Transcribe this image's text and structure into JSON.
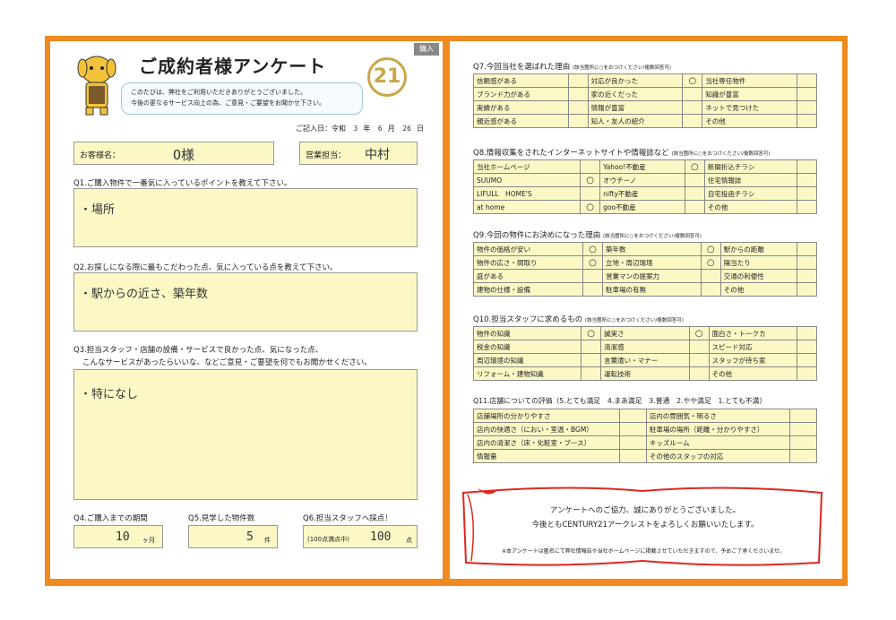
{
  "left": {
    "badge": "購入",
    "title": "ご成約者様アンケート",
    "intro_1": "このたびは、弊社をご利用いただきありがとうございました。",
    "intro_2": "今後の更なるサービス向上の為、ご意見・ご要望をお聞かせ下さい。",
    "logo": "21",
    "date_label": "ご記入日：令和",
    "date_year": "3",
    "date_month": "6",
    "date_day": "26",
    "date_y": "年",
    "date_m": "月",
    "date_d": "日",
    "customer_label": "お客様名：",
    "customer_value": "O様",
    "staff_label": "営業担当：",
    "staff_value": "中村",
    "q1": "Q1.ご購入物件で一番気に入っているポイントを教えて下さい。",
    "a1": "・場所",
    "q2": "Q2.お探しになる際に最もこだわった点、気に入っている点を教えて下さい。",
    "a2": "・駅からの近さ、築年数",
    "q3a": "Q3.担当スタッフ・店舗の設備・サービスで良かった点、気になった点、",
    "q3b": "こんなサービスがあったらいいな、などご意見・ご要望を何でもお聞かせください。",
    "a3": "・特になし",
    "q4": "Q4.ご購入までの期間",
    "a4": "10",
    "a4_unit": "ヶ月",
    "q5": "Q5.見学した物件数",
    "a5": "5",
    "a5_unit": "件",
    "q6": "Q6.担当スタッフへ採点！",
    "a6_note": "(100点満点中)",
    "a6": "100",
    "a6_unit": "点"
  },
  "right": {
    "q7": "Q7.今回当社を選ばれた理由",
    "q7_note": "(該当箇所に○をおつけください/複数回答可)",
    "q7_rows": [
      [
        "信頼感がある",
        "",
        "対応が良かった",
        "○",
        "当社専任物件",
        ""
      ],
      [
        "ブランド力がある",
        "",
        "家の近くだった",
        "",
        "知識が豊富",
        ""
      ],
      [
        "実績がある",
        "",
        "情報が豊富",
        "",
        "ネットで見つけた",
        ""
      ],
      [
        "親近感がある",
        "",
        "知人・友人の紹介",
        "",
        "その他",
        ""
      ]
    ],
    "q8": "Q8.情報収集をされたインターネットサイトや情報誌など",
    "q8_note": "(該当箇所に○をおつけください/複数回答可)",
    "q8_rows": [
      [
        "当社ホームページ",
        "",
        "Yahoo!不動産",
        "○",
        "新聞折込チラシ",
        ""
      ],
      [
        "SUUMO",
        "○",
        "オウチーノ",
        "",
        "住宅情報誌",
        ""
      ],
      [
        "LIFULL　HOME'S",
        "",
        "nifty不動産",
        "",
        "自宅投函チラシ",
        ""
      ],
      [
        "at home",
        "○",
        "goo不動産",
        "",
        "その他",
        ""
      ]
    ],
    "q9": "Q9.今回の物件にお決めになった理由",
    "q9_note": "(該当箇所に○をおつけください/複数回答可)",
    "q9_rows": [
      [
        "物件の価格が安い",
        "○",
        "築年数",
        "○",
        "駅からの距離",
        ""
      ],
      [
        "物件の広さ・間取り",
        "○",
        "立地・周辺環境",
        "○",
        "陽当たり",
        ""
      ],
      [
        "庭がある",
        "",
        "営業マンの提案力",
        "",
        "交通の利便性",
        ""
      ],
      [
        "建物の仕様・設備",
        "",
        "駐車場の有無",
        "",
        "その他",
        ""
      ]
    ],
    "q10": "Q10.担当スタッフに求めるもの",
    "q10_note": "(該当箇所に○をおつけください/複数回答可)",
    "q10_rows": [
      [
        "物件の知識",
        "○",
        "誠実さ",
        "○",
        "面白さ・トークカ",
        ""
      ],
      [
        "税金の知識",
        "",
        "清潔感",
        "",
        "スピード対応",
        ""
      ],
      [
        "周辺環境の知識",
        "",
        "言葉遣い・マナー",
        "",
        "スタッフが待ち家",
        ""
      ],
      [
        "リフォーム・建物知識",
        "",
        "運転技術",
        "",
        "その他",
        ""
      ]
    ],
    "q11": "Q11.店舗についての評価（5.とても満足　4.まあ満足　3.普通　2.やや満足　1.とても不満）",
    "q11_rows": [
      [
        "店舗場所の分かりやすさ",
        "",
        "店内の雰囲気・明るさ",
        ""
      ],
      [
        "店内の快適さ（におい・室温・BGM）",
        "",
        "駐車場の場所（距離・分かりやすさ）",
        ""
      ],
      [
        "店内の清潔さ（床・化粧室・ブース）",
        "",
        "キッズルーム",
        ""
      ],
      [
        "情報量",
        "",
        "その他のスタッフの対応",
        ""
      ]
    ],
    "thanks_1": "アンケートへのご協力、誠にありがとうございました。",
    "thanks_2": "今後ともCENTURY21アークレストをよろしくお願いいたします。",
    "fine": "※本アンケートは匿名にて弊社情報誌や当社ホームページに掲載させていただきますので、予めご了承くださいませ。"
  },
  "colors": {
    "frame": "#f08a1e",
    "fill": "#fbf8c6",
    "ribbon": "#e0261f",
    "logo": "#c9a648"
  }
}
